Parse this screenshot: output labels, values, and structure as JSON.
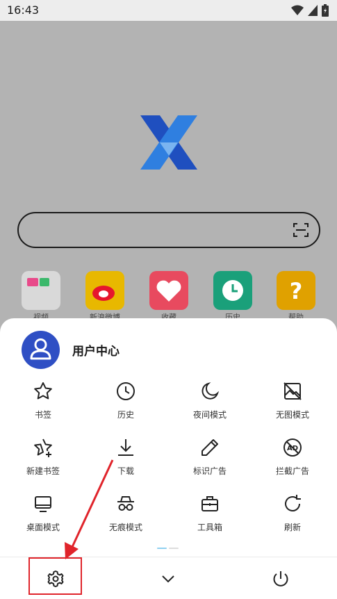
{
  "status_bar": {
    "time": "16:43",
    "icons": [
      "wifi-icon",
      "signal-icon",
      "battery-icon"
    ]
  },
  "browser": {
    "logo": "x-browser-logo",
    "search": {
      "placeholder": "",
      "scan_icon": "scan-icon"
    },
    "shortcuts": [
      {
        "label": "视频",
        "icon": "video-folder-icon",
        "color": "#d9d9d9"
      },
      {
        "label": "新浪微博",
        "icon": "weibo-icon",
        "color": "#e8b800"
      },
      {
        "label": "收藏",
        "icon": "heart-icon",
        "color": "#e84a5f"
      },
      {
        "label": "历史",
        "icon": "clock-icon",
        "color": "#1aa07a"
      },
      {
        "label": "帮助",
        "icon": "help-icon",
        "color": "#e0a100"
      }
    ]
  },
  "menu": {
    "user": {
      "title": "用户中心",
      "avatar_color": "#2f4fc4"
    },
    "items": [
      {
        "label": "书签",
        "icon": "star-icon"
      },
      {
        "label": "历史",
        "icon": "clock-icon"
      },
      {
        "label": "夜间模式",
        "icon": "moon-icon"
      },
      {
        "label": "无图模式",
        "icon": "no-image-icon"
      },
      {
        "label": "新建书签",
        "icon": "star-plus-icon"
      },
      {
        "label": "下载",
        "icon": "download-icon"
      },
      {
        "label": "标识广告",
        "icon": "pencil-icon"
      },
      {
        "label": "拦截广告",
        "icon": "ad-block-icon"
      },
      {
        "label": "桌面模式",
        "icon": "monitor-icon"
      },
      {
        "label": "无痕模式",
        "icon": "incognito-icon"
      },
      {
        "label": "工具箱",
        "icon": "toolbox-icon"
      },
      {
        "label": "刷新",
        "icon": "refresh-icon"
      }
    ],
    "pager": {
      "active_color": "#8fd0f0",
      "inactive_color": "#dddddd",
      "pages": 2,
      "active_index": 0
    },
    "bottom_bar": [
      "settings-icon",
      "chevron-down-icon",
      "power-icon"
    ]
  },
  "annotation": {
    "color": "#e0242b",
    "target": "settings-button"
  }
}
